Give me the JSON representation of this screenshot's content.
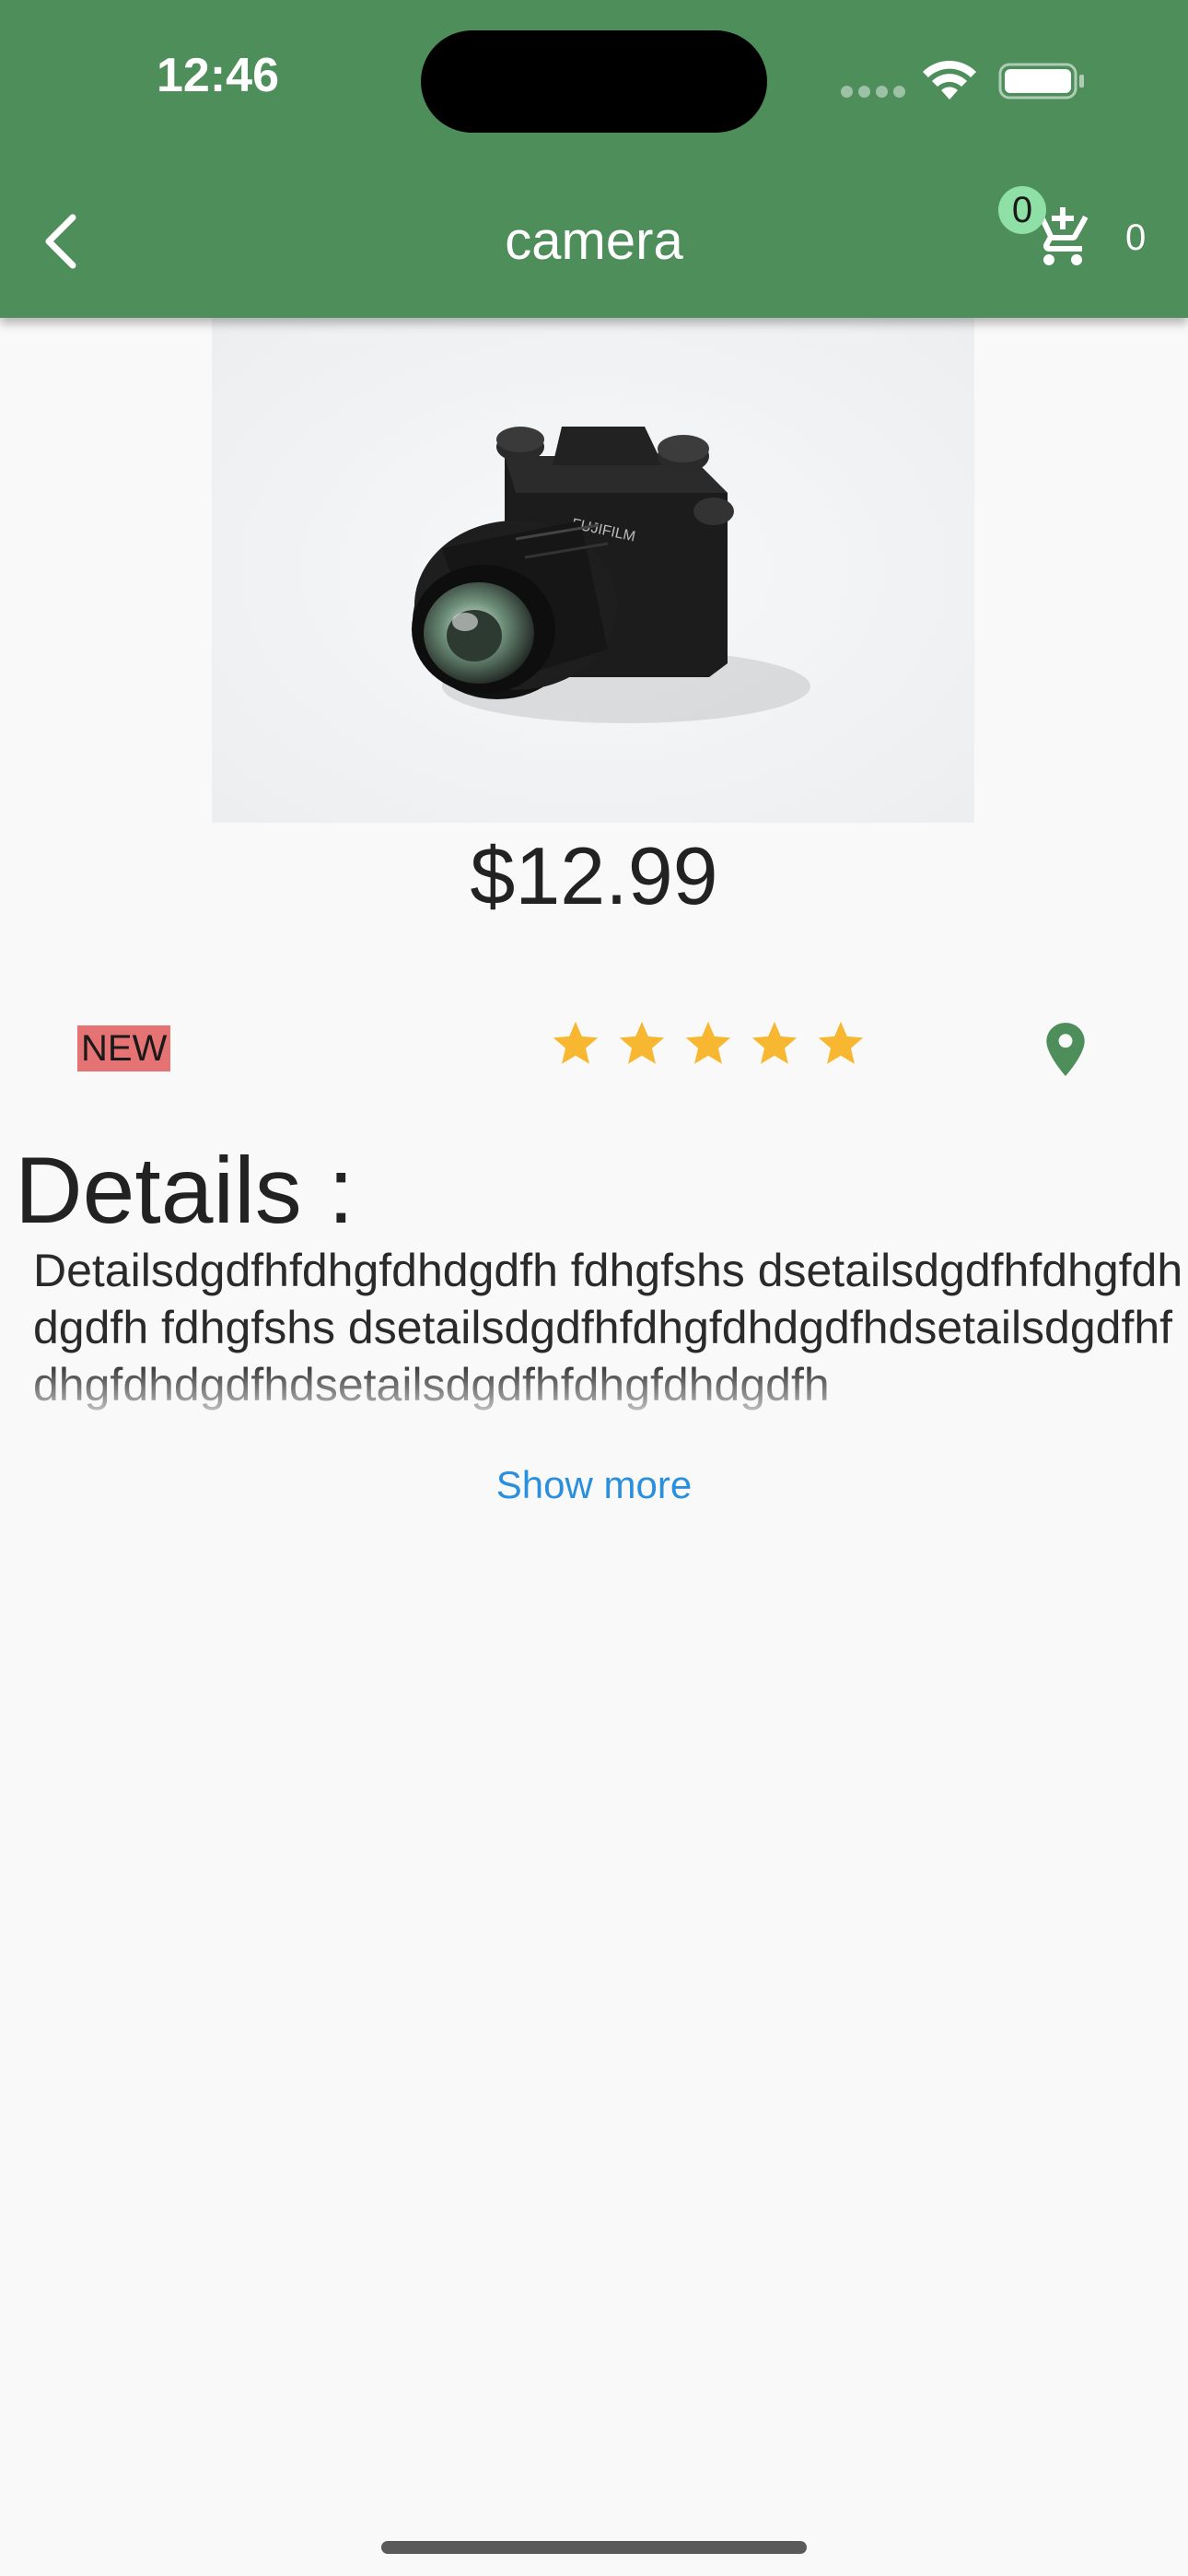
{
  "status_bar": {
    "time": "12:46"
  },
  "header": {
    "title": "camera",
    "cart_badge": "0",
    "cart_count": "0",
    "background_color": "#4e8e5b"
  },
  "product": {
    "image_description_icon": "camera-photo",
    "price": "$12.99",
    "badge": "NEW",
    "rating": 5,
    "rating_max": 5,
    "star_color": "#f7b731",
    "location_icon": "location-pin-icon"
  },
  "details": {
    "heading": "Details :",
    "text": "Detailsdgdfhfdhgfdhdgdfh fdhgfshs dsetailsdgdfhfdhgfdhdgdfh fdhgfshs dsetailsdgdfhfdhgfdhdgdfhdsetailsdgdfhfdhgfdhdgdfhdsetailsdgdfhfdhgfdhdgdfh",
    "show_more": "Show more",
    "link_color": "#2a8fdc"
  }
}
